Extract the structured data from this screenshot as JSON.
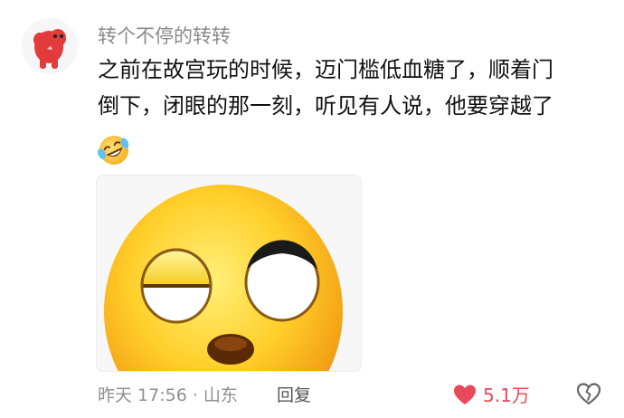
{
  "comment": {
    "username": "转个不停的转转",
    "content_lines": [
      "之前在故宫玩的时候，迈门槛低血糖了，顺着门",
      "倒下，闭眼的那一刻，听见有人说，他要穿越了"
    ],
    "inline_emoji": "laughing-crying-emoji",
    "media_icon": "one-eye-closed-emoji-image",
    "meta": "昨天 17:56 · 山东",
    "reply_label": "回复",
    "like_count": "5.1万",
    "like_active": true,
    "colors": {
      "like": "#e8495a",
      "meta": "#8f8f94",
      "username": "#8a8a8f",
      "avatar_figure": "#e33b3b"
    }
  }
}
